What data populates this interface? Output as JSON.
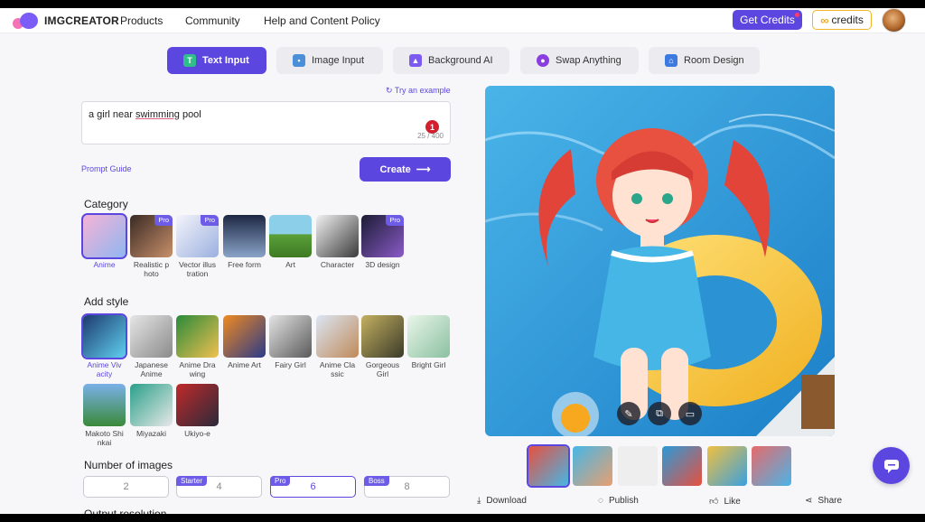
{
  "nav": {
    "logo_text": "IMGCREATOR",
    "links": [
      "Products",
      "Community",
      "Help and Content Policy"
    ],
    "get_credits": "Get Credits",
    "credits_label": "credits",
    "credits_icon": "∞"
  },
  "tabs": [
    {
      "label": "Text Input",
      "icon": "text-input-icon",
      "active": true
    },
    {
      "label": "Image Input",
      "icon": "image-input-icon",
      "active": false
    },
    {
      "label": "Background AI",
      "icon": "background-ai-icon",
      "active": false
    },
    {
      "label": "Swap Anything",
      "icon": "swap-anything-icon",
      "active": false
    },
    {
      "label": "Room Design",
      "icon": "room-design-icon",
      "active": false
    }
  ],
  "prompt": {
    "try_example": "Try an example",
    "text_before": "a girl near ",
    "text_underlined": "swimming",
    "text_after": " pool",
    "counter": "25 / 400",
    "error_badge": "1"
  },
  "prompt_guide": "Prompt Guide",
  "create_label": "Create",
  "category": {
    "title": "Category",
    "items": [
      {
        "line1": "Anime",
        "line2": "",
        "pro": false,
        "selected": true
      },
      {
        "line1": "Realistic p",
        "line2": "hoto",
        "pro": true,
        "selected": false
      },
      {
        "line1": "Vector illus",
        "line2": "tration",
        "pro": true,
        "selected": false
      },
      {
        "line1": "Free form",
        "line2": "",
        "pro": false,
        "selected": false
      },
      {
        "line1": "Art",
        "line2": "",
        "pro": false,
        "selected": false
      },
      {
        "line1": "Character",
        "line2": "",
        "pro": false,
        "selected": false
      },
      {
        "line1": "3D design",
        "line2": "",
        "pro": true,
        "selected": false
      }
    ]
  },
  "style": {
    "title": "Add style",
    "items": [
      {
        "line1": "Anime Viv",
        "line2": "acity",
        "selected": true
      },
      {
        "line1": "Japanese",
        "line2": "Anime",
        "selected": false
      },
      {
        "line1": "Anime Dra",
        "line2": "wing",
        "selected": false
      },
      {
        "line1": "Anime Art",
        "line2": "",
        "selected": false
      },
      {
        "line1": "Fairy Girl",
        "line2": "",
        "selected": false
      },
      {
        "line1": "Anime Cla",
        "line2": "ssic",
        "selected": false
      },
      {
        "line1": "Gorgeous",
        "line2": "Girl",
        "selected": false
      },
      {
        "line1": "Bright Girl",
        "line2": "",
        "selected": false
      },
      {
        "line1": "Makoto Shi",
        "line2": "nkai",
        "selected": false
      },
      {
        "line1": "Miyazaki",
        "line2": "",
        "selected": false
      },
      {
        "line1": "Ukiyo-e",
        "line2": "",
        "selected": false
      }
    ]
  },
  "pro_label": "Pro",
  "num_images": {
    "title": "Number of images",
    "options": [
      {
        "value": "2",
        "tag": "",
        "selected": false
      },
      {
        "value": "4",
        "tag": "Starter",
        "selected": false
      },
      {
        "value": "6",
        "tag": "Pro",
        "selected": true
      },
      {
        "value": "8",
        "tag": "Boss",
        "selected": false
      }
    ]
  },
  "output_resolution_title": "Output resolution",
  "actions": [
    "Download",
    "Publish",
    "Like",
    "Share"
  ],
  "colors": {
    "accent": "#5b47e0",
    "badge_red": "#d2202f",
    "gold": "#f0b428"
  }
}
